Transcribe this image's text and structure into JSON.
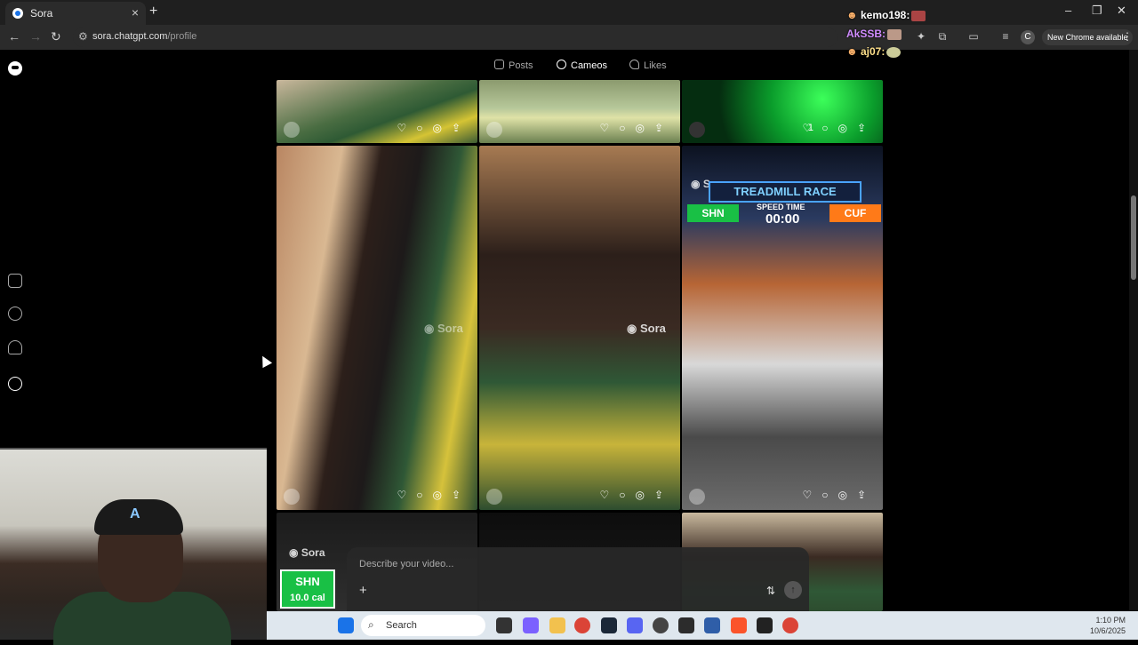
{
  "browser": {
    "tab_title": "Sora",
    "tab_close": "×",
    "new_tab": "+",
    "url_host": "sora.chatgpt.com",
    "url_path": "/profile",
    "new_chrome_label": "New Chrome available",
    "profile_initial": "C",
    "window_controls": [
      "–",
      "❐",
      "✕"
    ]
  },
  "chat": [
    {
      "user": "kemo198:"
    },
    {
      "user": "AkSSB:"
    },
    {
      "user": "aj07:"
    }
  ],
  "profile_tabs": [
    {
      "label": "Posts",
      "icon": "play-icon",
      "active": false
    },
    {
      "label": "Cameos",
      "icon": "cameo-icon",
      "active": true
    },
    {
      "label": "Likes",
      "icon": "heart-icon",
      "active": false
    }
  ],
  "grid": {
    "watermark": "Sora",
    "like_count_c": "1",
    "treadmill": {
      "title": "TREADMILL RACE",
      "left": "SHN",
      "right": "CUF",
      "labels": "SPEED   TIME",
      "time": "00:00"
    },
    "bottom_overlay": {
      "a": "SHN",
      "b": "10.0 cal"
    }
  },
  "composer": {
    "placeholder": "Describe your video...",
    "plus": "+",
    "send": "↑"
  },
  "taskbar": {
    "search_label": "Search",
    "time": "1:10 PM",
    "date": "10/6/2025"
  },
  "colors": {
    "accent_green": "#19c045",
    "accent_orange": "#ff7a18",
    "taskbar": "#dfe7ee"
  }
}
